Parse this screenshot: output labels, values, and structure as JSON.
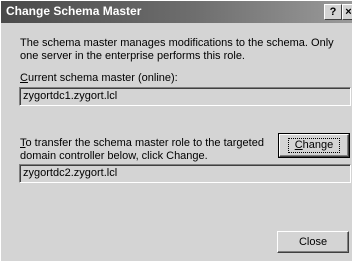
{
  "window": {
    "title": "Change Schema Master",
    "help_label": "?",
    "close_label": "×"
  },
  "description": "The schema master manages modifications to the schema. Only one server in the enterprise performs this role.",
  "current": {
    "label_prefix": "C",
    "label_rest": "urrent schema master (online):",
    "value": "zygortdc1.zygort.lcl"
  },
  "transfer": {
    "label_prefix": "T",
    "label_rest": "o transfer the schema master role to the targeted domain controller below, click Change.",
    "value": "zygortdc2.zygort.lcl"
  },
  "buttons": {
    "change_prefix": "C",
    "change_rest": "hange",
    "close": "Close"
  }
}
